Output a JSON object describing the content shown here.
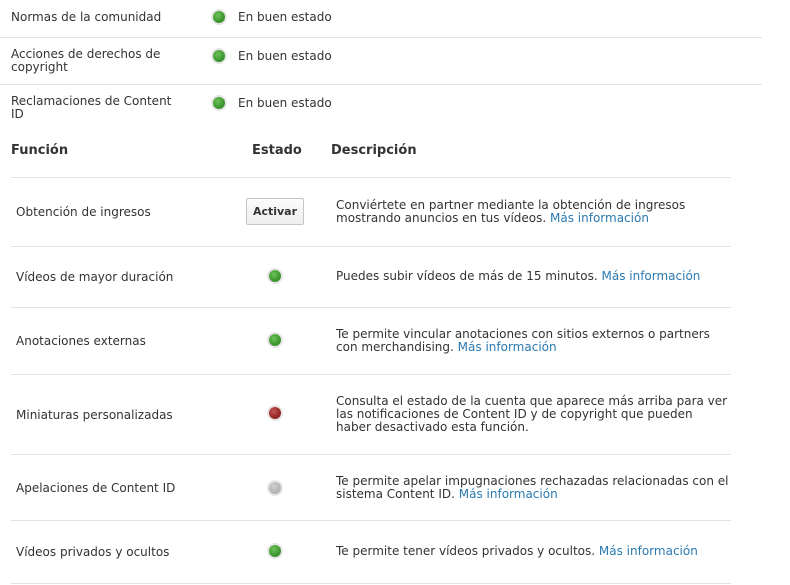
{
  "account_status": [
    {
      "label": "Normas de la comunidad",
      "status": "En buen estado",
      "color": "#3f9a31"
    },
    {
      "label": "Acciones de derechos de copyright",
      "status": "En buen estado",
      "color": "#3f9a31"
    },
    {
      "label": "Reclamaciones de Content ID",
      "status": "En buen estado",
      "color": "#3f9a31"
    }
  ],
  "table": {
    "headers": {
      "feature": "Función",
      "status": "Estado",
      "description": "Descripción"
    },
    "rows": [
      {
        "name": "Obtención de ingresos",
        "action_label": "Activar",
        "description": "Conviértete en partner mediante la obtención de ingresos mostrando anuncios en tus vídeos.",
        "link": "Más información"
      },
      {
        "name": "Vídeos de mayor duración",
        "status_color": "green",
        "description": "Puedes subir vídeos de más de 15 minutos.",
        "link": "Más información"
      },
      {
        "name": "Anotaciones externas",
        "status_color": "green",
        "description": "Te permite vincular anotaciones con sitios externos o partners con merchandising.",
        "link": "Más información"
      },
      {
        "name": "Miniaturas personalizadas",
        "status_color": "red",
        "description": "Consulta el estado de la cuenta que aparece más arriba para ver las notificaciones de Content ID y de copyright que pueden haber desactivado esta función."
      },
      {
        "name": "Apelaciones de Content ID",
        "status_color": "gray",
        "description": "Te permite apelar impugnaciones rechazadas relacionadas con el sistema Content ID.",
        "link": "Más información"
      },
      {
        "name": "Vídeos privados y ocultos",
        "status_color": "green",
        "description": "Te permite tener vídeos privados y ocultos.",
        "link": "Más información"
      }
    ]
  },
  "colors": {
    "green": "#3f9a31",
    "red": "#9b2a2a",
    "gray": "#b4b4b4",
    "link": "#2a7ab0"
  }
}
